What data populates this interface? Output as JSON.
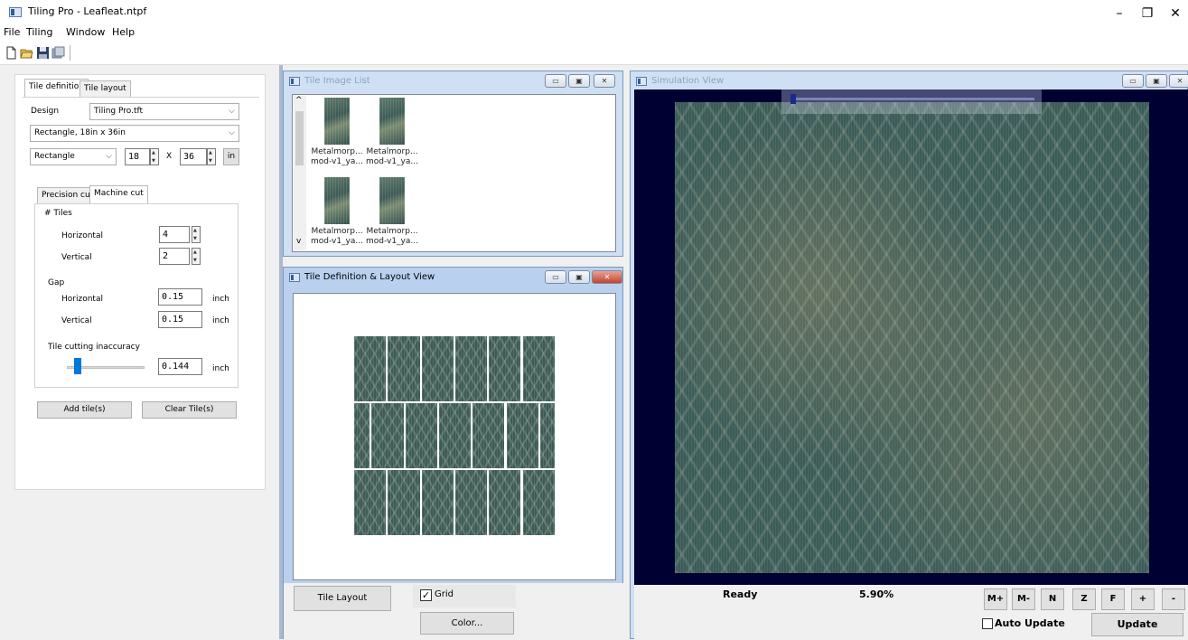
{
  "window": {
    "title": "Tiling Pro - Leafleat.ntpf",
    "minimize_glyph": "–",
    "restore_glyph": "❐",
    "close_glyph": "✕"
  },
  "menu": [
    "File",
    "Tiling",
    "Window",
    "Help"
  ],
  "toolbar": {
    "icons": [
      "new-file-icon",
      "open-folder-icon",
      "save-icon",
      "save-as-icon"
    ]
  },
  "left_panel": {
    "tabs": [
      "Tile definition",
      "Tile layout"
    ],
    "design_label": "Design",
    "design_value": "Tiling Pro.tft",
    "size_value": "Rectangle, 18in x 36in",
    "shape_value": "Rectangle",
    "width_value": "18",
    "x_label": "X",
    "height_value": "36",
    "unit_button": "in",
    "cut_tabs": [
      "Precision cut",
      "Machine cut"
    ],
    "tiles_label": "# Tiles",
    "horizontal_label": "Horizontal",
    "horizontal_value": "4",
    "vertical_label": "Vertical",
    "vertical_value": "2",
    "gap_label": "Gap",
    "gap_horizontal_label": "Horizontal",
    "gap_horizontal_value": "0.15",
    "gap_horizontal_unit": "inch",
    "gap_vertical_label": "Vertical",
    "gap_vertical_value": "0.15",
    "gap_vertical_unit": "inch",
    "inaccuracy_label": "Tile cutting inaccuracy",
    "inaccuracy_value": "0.144",
    "inaccuracy_unit": "inch",
    "add_button": "Add tile(s)",
    "clear_button": "Clear Tile(s)"
  },
  "tile_image_list": {
    "title": "Tile Image List",
    "items": [
      {
        "line1": "Metalmorp...",
        "line2": "mod-v1_ya..."
      },
      {
        "line1": "Metalmorp...",
        "line2": "mod-v1_ya..."
      },
      {
        "line1": "Metalmorp...",
        "line2": "mod-v1_ya..."
      },
      {
        "line1": "Metalmorp...",
        "line2": "mod-v1_ya..."
      }
    ],
    "scroll_up": "^",
    "scroll_down": "v"
  },
  "layout_view": {
    "title": "Tile Definition & Layout View",
    "tile_layout_button": "Tile Layout",
    "grid_label": "Grid",
    "grid_checked": true,
    "color_button": "Color..."
  },
  "simulation_view": {
    "title": "Simulation View",
    "status": "Ready",
    "percent": "5.90%",
    "buttons": [
      "M+",
      "M-",
      "N",
      "Z",
      "F",
      "+",
      "-"
    ],
    "auto_update_label": "Auto Update",
    "auto_update_checked": false,
    "update_button": "Update"
  },
  "colors": {
    "sim_background": "#000033",
    "tile_green": "#3c5a56",
    "mdi_frame": "#cfe0f4"
  }
}
